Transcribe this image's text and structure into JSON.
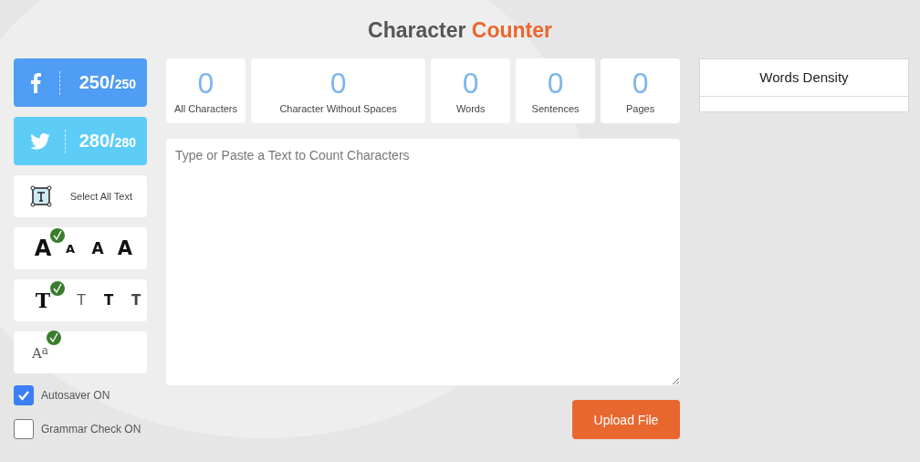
{
  "title": {
    "part_1": "Character",
    "part_2": "Counter"
  },
  "social": [
    {
      "kind": "facebook",
      "count": "250/",
      "max": "250"
    },
    {
      "kind": "twitter",
      "count": "280/",
      "max": "280"
    }
  ],
  "select_all": {
    "label": "Select All Text"
  },
  "font_sizes": [
    {
      "glyph": "A",
      "selected": true
    },
    {
      "glyph": "A",
      "selected": false
    },
    {
      "glyph": "A",
      "selected": false
    },
    {
      "glyph": "A",
      "selected": false
    }
  ],
  "font_weights": [
    {
      "glyph": "T",
      "selected": true
    },
    {
      "glyph": "T",
      "selected": false
    },
    {
      "glyph": "T",
      "selected": false
    },
    {
      "glyph": "T",
      "selected": false
    }
  ],
  "case_toggle": {
    "glyph": "A",
    "glyph_small": "a",
    "selected": true
  },
  "options": [
    {
      "label": "Autosaver ON",
      "checked": true
    },
    {
      "label": "Grammar Check ON",
      "checked": false
    }
  ],
  "stats": [
    {
      "value": "0",
      "label": "All Characters"
    },
    {
      "value": "0",
      "label": "Character Without Spaces"
    },
    {
      "value": "0",
      "label": "Words"
    },
    {
      "value": "0",
      "label": "Sentences"
    },
    {
      "value": "0",
      "label": "Pages"
    }
  ],
  "editor": {
    "placeholder": "Type or Paste a Text to Count Characters"
  },
  "upload_button": "Upload File",
  "density": {
    "title": "Words Density"
  }
}
